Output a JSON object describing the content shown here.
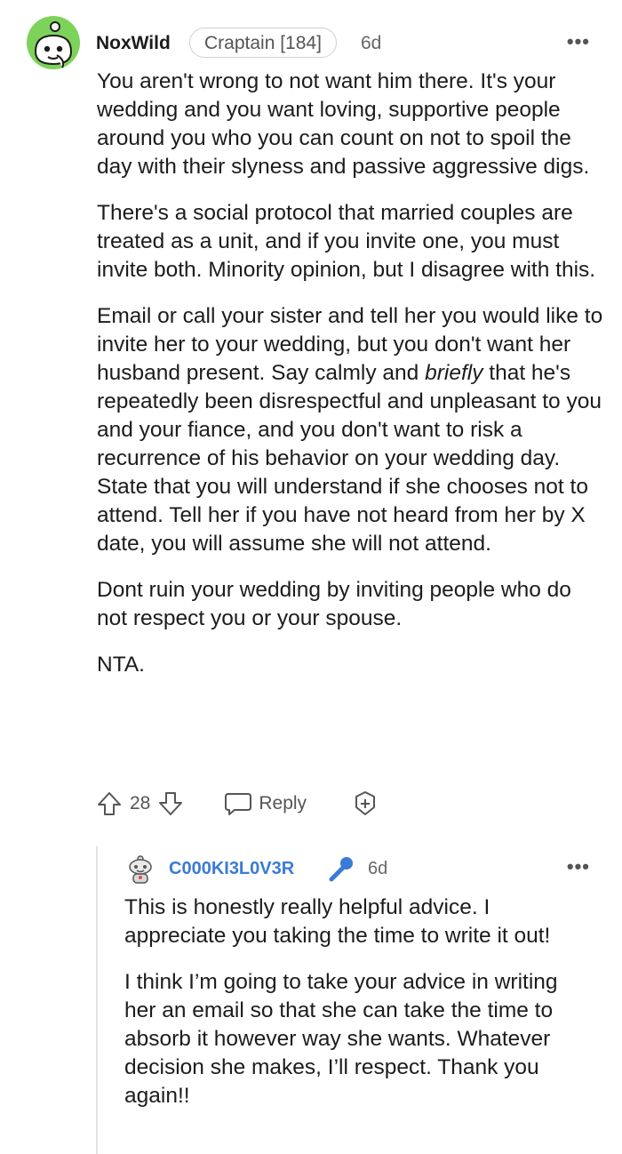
{
  "comment": {
    "username": "NoxWild",
    "flair": "Craptain [184]",
    "age": "6d",
    "more": "•••",
    "paragraphs": [
      "You aren't wrong to not want him there. It's your wedding and you want loving, supportive people around you who you can count on not to spoil the day with their slyness and passive aggressive digs.",
      "There's a social protocol that married couples are treated as a unit, and if you invite one, you must invite both. Minority opinion, but I disagree with this.",
      "Dont ruin your wedding by inviting people who do not respect you or your spouse.",
      "NTA."
    ],
    "p3_before": "Email or call your sister and tell her you would like to invite her to your wedding, but you don't want her husband present. Say calmly and ",
    "p3_em": "briefly",
    "p3_after": " that he's repeatedly been disrespectful and unpleasant to you and your fiance, and you don't want to risk a recurrence of his behavior on your wedding day. State that you will understand if she chooses not to attend. Tell her if you have not heard from her by X date, you will assume she will not attend.",
    "votes": "28",
    "reply_label": "Reply",
    "icons": [
      "snoo-avatar-icon",
      "upvote-icon",
      "downvote-icon",
      "reply-bubble-icon",
      "award-icon"
    ]
  },
  "reply": {
    "username": "C000KI3L0V3R",
    "age": "6d",
    "more": "•••",
    "paragraphs": [
      "This is honestly really helpful advice. I appreciate you taking the time to write it out!",
      "I think I’m going to take your advice in writing her an email so that she can take the time to absorb it however way she wants. Whatever decision she makes, I’ll respect. Thank you again!!"
    ],
    "icons": [
      "snoo-avatar-icon",
      "op-microphone-icon"
    ]
  },
  "colors": {
    "username_reply": "#3a7bd5",
    "avatar_bg": "#7dd35a",
    "mic": "#3a7bd5"
  }
}
